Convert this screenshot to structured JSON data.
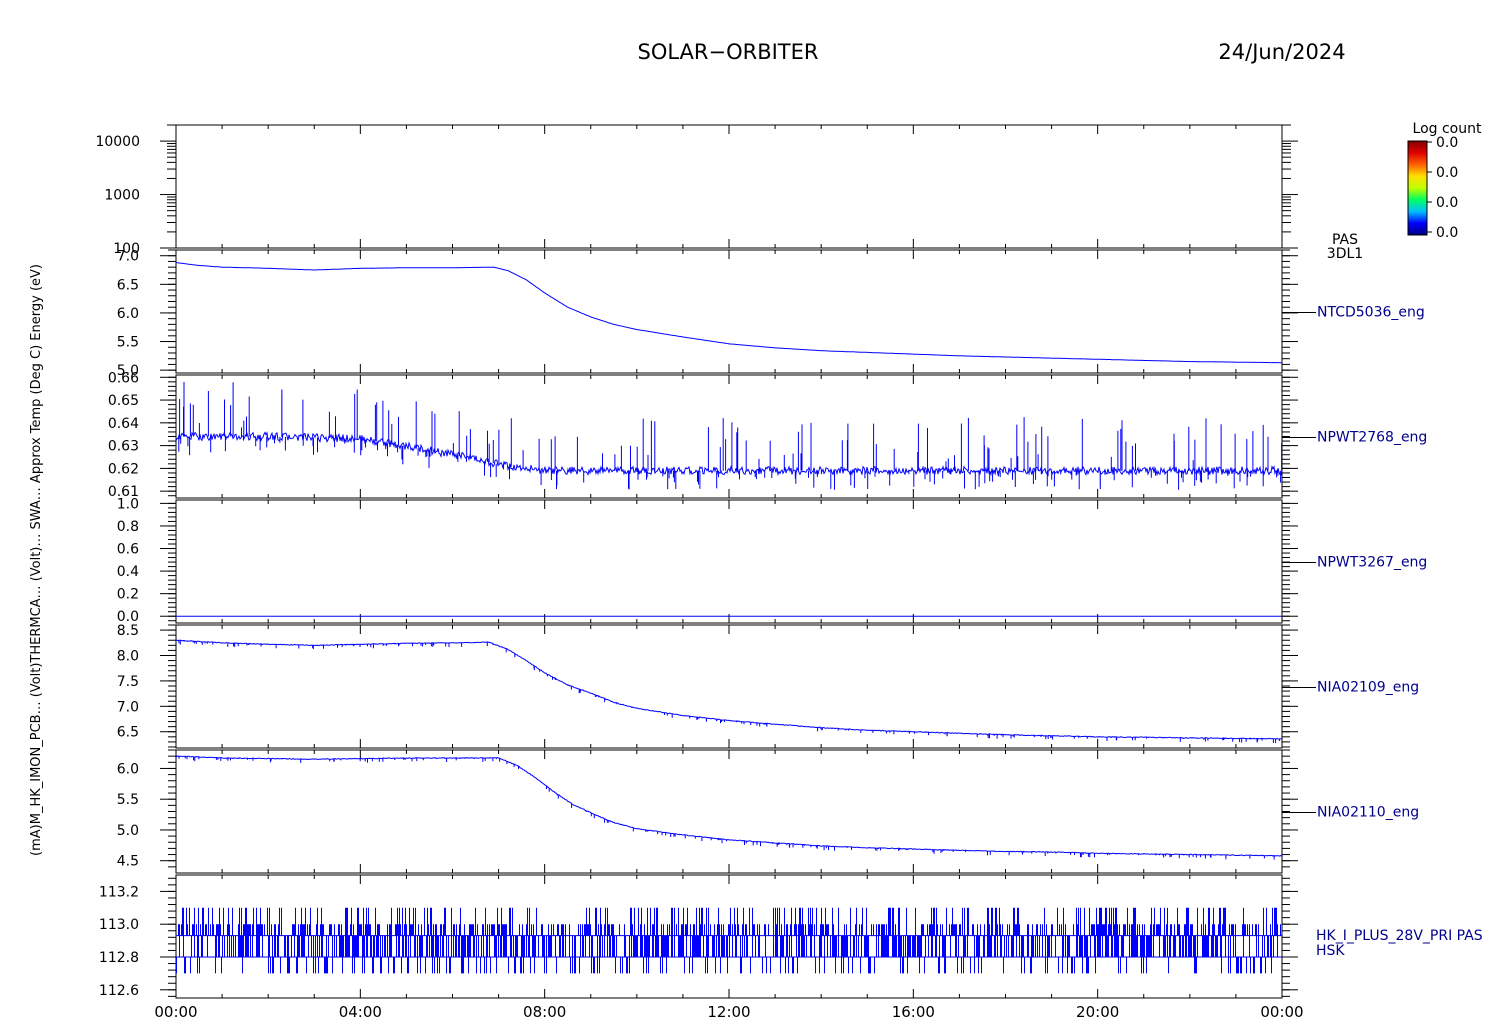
{
  "header": {
    "mission": "SOLAR−ORBITER",
    "date": "24/Jun/2024"
  },
  "colorbar": {
    "title": "Log count",
    "ticks": [
      "0.0",
      "0.0",
      "0.0",
      "0.0"
    ],
    "colors": [
      "#000080",
      "#0000ff",
      "#00c0ff",
      "#00ff60",
      "#c0ff00",
      "#ffe000",
      "#ff6000",
      "#e00000",
      "#800000"
    ]
  },
  "side_label": "(mA)M_HK_IMON_PCB… (Volt)THERMCA… (Volt)… SWA… Approx Temp (Deg C) Energy (eV)",
  "trace_color": "#0000ff",
  "chart_data": [
    {
      "type": "heatmap",
      "ylabel": "",
      "yscale": "log",
      "ylim": [
        100,
        20000
      ],
      "yticks": [
        "10000",
        "1000",
        "100"
      ],
      "right_label": [
        "PAS",
        "3DL1"
      ],
      "z": []
    },
    {
      "type": "line",
      "right_label": "NTCD5036_eng",
      "ylim": [
        4.95,
        7.1
      ],
      "yticks": [
        "7.0",
        "6.5",
        "6.0",
        "5.5",
        "5.0"
      ],
      "x": [
        0,
        0.5,
        1,
        2,
        3,
        4,
        5,
        6,
        6.9,
        7.2,
        7.6,
        8,
        8.5,
        9,
        9.5,
        10,
        11,
        12,
        13,
        14,
        15,
        16,
        17,
        18,
        19,
        20,
        21,
        22,
        23,
        24
      ],
      "y": [
        6.88,
        6.83,
        6.8,
        6.78,
        6.75,
        6.78,
        6.79,
        6.79,
        6.8,
        6.74,
        6.58,
        6.35,
        6.1,
        5.93,
        5.8,
        5.71,
        5.58,
        5.46,
        5.39,
        5.34,
        5.31,
        5.28,
        5.25,
        5.23,
        5.21,
        5.19,
        5.17,
        5.15,
        5.14,
        5.13
      ]
    },
    {
      "type": "line",
      "right_label": "NPWT2768_eng",
      "ylim": [
        0.607,
        0.661
      ],
      "yticks": [
        "0.66",
        "0.65",
        "0.64",
        "0.63",
        "0.62",
        "0.61"
      ],
      "x": [
        0,
        2,
        4,
        5.5,
        6.5,
        7.2,
        8,
        10,
        14,
        18,
        22,
        24
      ],
      "y": [
        0.634,
        0.634,
        0.633,
        0.628,
        0.624,
        0.621,
        0.619,
        0.619,
        0.619,
        0.619,
        0.619,
        0.619
      ]
    },
    {
      "type": "line",
      "right_label": "NPWT3267_eng",
      "ylim": [
        -0.06,
        1.03
      ],
      "yticks": [
        "1.0",
        "0.8",
        "0.6",
        "0.4",
        "0.2",
        "0.0"
      ],
      "x": [
        0,
        24
      ],
      "y": [
        0,
        0
      ]
    },
    {
      "type": "line",
      "right_label": "NIA02109_eng",
      "ylim": [
        6.18,
        8.6
      ],
      "yticks": [
        "8.5",
        "8.0",
        "7.5",
        "7.0",
        "6.5"
      ],
      "x": [
        0,
        1,
        2,
        3,
        4,
        5,
        6,
        6.8,
        7.2,
        7.6,
        8,
        8.5,
        9,
        9.5,
        10,
        11,
        12,
        13,
        14,
        15,
        16,
        17,
        18,
        19,
        20,
        21,
        22,
        23,
        24
      ],
      "y": [
        8.3,
        8.25,
        8.22,
        8.2,
        8.22,
        8.24,
        8.25,
        8.26,
        8.12,
        7.9,
        7.66,
        7.42,
        7.26,
        7.08,
        6.96,
        6.82,
        6.72,
        6.65,
        6.58,
        6.53,
        6.5,
        6.47,
        6.44,
        6.42,
        6.4,
        6.39,
        6.38,
        6.37,
        6.36
      ]
    },
    {
      "type": "line",
      "right_label": "NIA02110_eng",
      "ylim": [
        4.3,
        6.3
      ],
      "yticks": [
        "6.0",
        "5.5",
        "5.0",
        "4.5"
      ],
      "x": [
        0,
        1,
        2,
        3,
        4,
        5,
        6,
        7,
        7.4,
        7.8,
        8.2,
        8.6,
        9,
        9.5,
        10,
        11,
        12,
        13,
        14,
        15,
        16,
        17,
        18,
        19,
        20,
        21,
        22,
        23,
        24
      ],
      "y": [
        6.2,
        6.17,
        6.16,
        6.15,
        6.16,
        6.17,
        6.17,
        6.17,
        6.05,
        5.85,
        5.62,
        5.42,
        5.28,
        5.12,
        5.02,
        4.92,
        4.84,
        4.79,
        4.74,
        4.71,
        4.69,
        4.67,
        4.65,
        4.64,
        4.62,
        4.61,
        4.6,
        4.59,
        4.58
      ]
    },
    {
      "type": "line",
      "right_label": [
        "HK_I_PLUS_28V_PRI PAS",
        "HSK"
      ],
      "ylim": [
        112.55,
        113.3
      ],
      "yticks": [
        "113.2",
        "113.0",
        "112.8",
        "112.6"
      ],
      "levels": [
        112.7,
        112.8,
        112.93,
        113.0,
        113.1
      ],
      "x": [
        0,
        24
      ],
      "y": [
        112.87,
        112.87
      ]
    }
  ],
  "xaxis": {
    "ticks": [
      "00:00",
      "04:00",
      "08:00",
      "12:00",
      "16:00",
      "20:00",
      "00:00"
    ],
    "xlim": [
      0,
      24
    ]
  }
}
